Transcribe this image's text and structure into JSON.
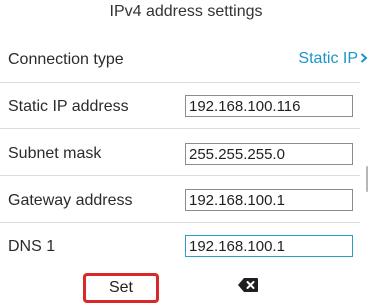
{
  "title": "IPv4 address settings",
  "connection_type": {
    "label": "Connection type",
    "value": "Static IP"
  },
  "fields": [
    {
      "label": "Static IP address",
      "value": "192.168.100.116"
    },
    {
      "label": "Subnet mask",
      "value": "255.255.255.0"
    },
    {
      "label": "Gateway address",
      "value": "192.168.100.1"
    },
    {
      "label": "DNS 1",
      "value": "192.168.100.1"
    }
  ],
  "softkeys": {
    "set_label": "Set",
    "backspace_icon": "backspace-icon"
  },
  "colors": {
    "accent": "#1a96c9",
    "highlight": "#d8282a"
  }
}
